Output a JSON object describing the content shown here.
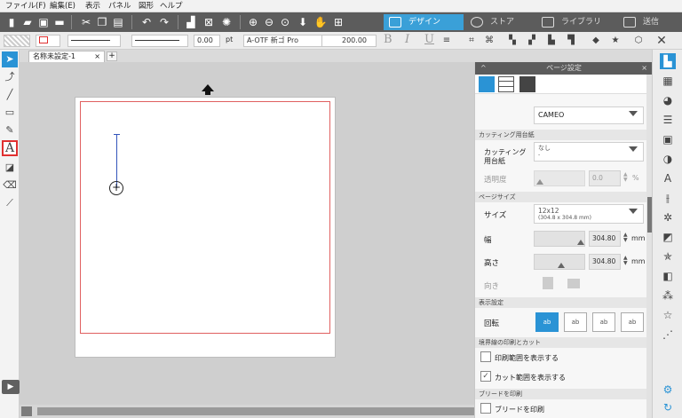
{
  "menu": [
    "ファイル(F)",
    "編集(E)",
    "表示",
    "パネル",
    "図形",
    "ヘルプ"
  ],
  "toolbar": {
    "icons": [
      "new-file-icon",
      "open-file-icon",
      "save-icon",
      "print-icon",
      "cut-icon",
      "copy-icon",
      "paste-icon",
      "undo-icon",
      "redo-icon",
      "bring-front-icon",
      "delete-icon",
      "select-all-icon",
      "zoom-in-icon",
      "zoom-out-icon",
      "zoom-fit-icon",
      "move-down-icon",
      "pan-hand-icon",
      "fit-page-icon"
    ],
    "tabs": [
      {
        "label": "デザイン",
        "icon": "grid-icon",
        "active": true
      },
      {
        "label": "ストア",
        "icon": "store-icon",
        "active": false
      },
      {
        "label": "ライブラリ",
        "icon": "library-icon",
        "active": false
      },
      {
        "label": "送信",
        "icon": "send-icon",
        "active": false
      }
    ]
  },
  "propbar": {
    "line_width": "0.00",
    "line_unit": "pt",
    "font_name": "A-OTF 新ゴ Pro",
    "font_size": "200.00",
    "bold": "B",
    "italic": "I",
    "underline": "U"
  },
  "doc_tab": {
    "title": "名称未設定-1",
    "close": "×",
    "add": "+"
  },
  "panel": {
    "title": "ページ設定",
    "close": "×",
    "collapse": "^",
    "machine": "CAMEO",
    "cutting_mat_section": "カッティング用台紙",
    "cutting_mat_label": "カッティング用台紙",
    "cutting_mat_value": "なし",
    "cutting_mat_sub": "-",
    "transparency_label": "透明度",
    "transparency_value": "0.0",
    "transparency_unit": "%",
    "page_size_section": "ページサイズ",
    "size_label": "サイズ",
    "size_value": "12x12",
    "size_sub": "(304.8 x 304.8 mm)",
    "width_label": "幅",
    "width_value": "304.80",
    "width_unit": "mm",
    "height_label": "高さ",
    "height_value": "304.80",
    "height_unit": "mm",
    "orientation_label": "向き",
    "display_section": "表示設定",
    "rotation_label": "回転",
    "rotation_option_labels": [
      "ab",
      "ab",
      "ab",
      "ab"
    ],
    "print_cut_section": "境界線の印刷とカット",
    "show_print_range": "印刷範囲を表示する",
    "show_cut_range": "カット範囲を表示する",
    "bleed_section": "ブリードを印刷",
    "print_bleed": "ブリードを印刷"
  },
  "rail_icons": [
    "page-setup-icon",
    "image-icon",
    "fill-color-icon",
    "line-style-icon",
    "offset-icon",
    "transparency-icon",
    "text-style-icon",
    "align-icon",
    "replicate-icon",
    "modify-icon",
    "transform-icon",
    "library-star-icon",
    "trace-icon",
    "sketch-icon",
    "star-icon",
    "scatter-icon",
    "settings-gear-icon",
    "refresh-icon"
  ]
}
